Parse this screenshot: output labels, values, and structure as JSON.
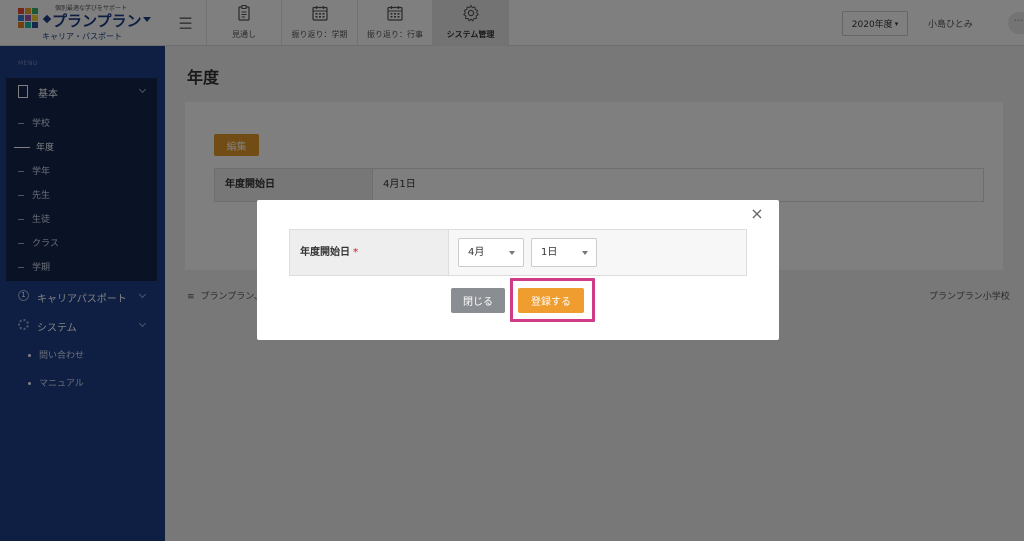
{
  "logo": {
    "tagline": "個別最適な学びをサポート",
    "name": "プランプラン",
    "subtitle": "キャリア・パスポート",
    "colors": [
      "#e64a3c",
      "#f0a030",
      "#3db36a",
      "#3b7fd0",
      "#9b59b6",
      "#f4d03f",
      "#e67e22",
      "#1abc9c",
      "#2e4d9b"
    ]
  },
  "header": {
    "menu_icon": "hamburger-icon",
    "tabs": [
      {
        "label": "見通し",
        "icon": "clipboard-icon"
      },
      {
        "label": "振り返り：学期",
        "icon": "calendar-icon"
      },
      {
        "label": "振り返り：行事",
        "icon": "calendar-icon"
      },
      {
        "label": "システム管理",
        "icon": "gear-icon",
        "active": true
      }
    ],
    "year_selector": "2020年度",
    "user_name": "小島ひとみ",
    "more": "···"
  },
  "sidebar": {
    "menu_label": "MENU",
    "groups": {
      "kihon": {
        "label": "基本",
        "icon": "document-icon"
      },
      "career": {
        "label": "キャリアパスポート",
        "icon": "circle-one-icon"
      },
      "system": {
        "label": "システム",
        "icon": "gear-icon"
      }
    },
    "kihon_items": [
      "学校",
      "年度",
      "学年",
      "先生",
      "生徒",
      "クラス",
      "学期"
    ],
    "active_item": "年度",
    "extra_items": [
      "問い合わせ",
      "マニュアル"
    ]
  },
  "main": {
    "page_title": "年度",
    "edit_label": "編集",
    "field_label": "年度開始日",
    "field_value": "4月1日",
    "footer_left": "プランプラン、",
    "footer_right": "プランプラン小学校"
  },
  "modal": {
    "close_icon": "×",
    "field_label": "年度開始日",
    "required_mark": "*",
    "month_value": "4月",
    "day_value": "1日",
    "close_label": "閉じる",
    "register_label": "登録する",
    "accent_color": "#ef9d2f",
    "highlight_color": "#cf3b86"
  }
}
